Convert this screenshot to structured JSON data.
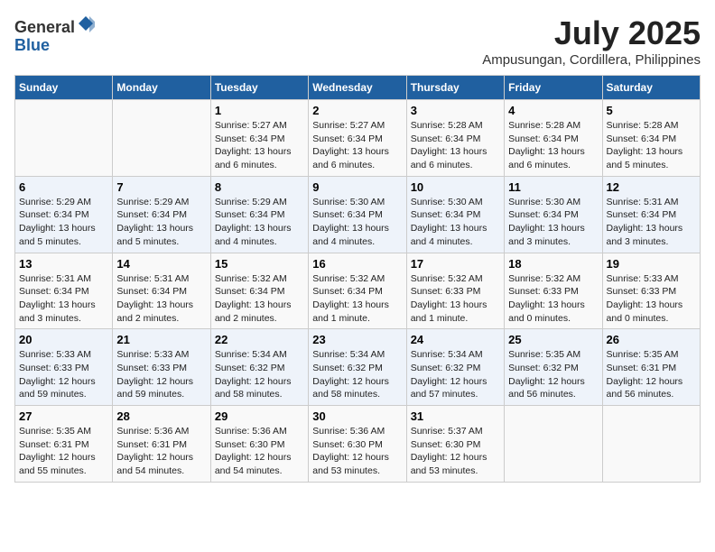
{
  "header": {
    "logo_general": "General",
    "logo_blue": "Blue",
    "month_title": "July 2025",
    "subtitle": "Ampusungan, Cordillera, Philippines"
  },
  "days_of_week": [
    "Sunday",
    "Monday",
    "Tuesday",
    "Wednesday",
    "Thursday",
    "Friday",
    "Saturday"
  ],
  "weeks": [
    [
      {
        "day": "",
        "info": ""
      },
      {
        "day": "",
        "info": ""
      },
      {
        "day": "1",
        "info": "Sunrise: 5:27 AM\nSunset: 6:34 PM\nDaylight: 13 hours and 6 minutes."
      },
      {
        "day": "2",
        "info": "Sunrise: 5:27 AM\nSunset: 6:34 PM\nDaylight: 13 hours and 6 minutes."
      },
      {
        "day": "3",
        "info": "Sunrise: 5:28 AM\nSunset: 6:34 PM\nDaylight: 13 hours and 6 minutes."
      },
      {
        "day": "4",
        "info": "Sunrise: 5:28 AM\nSunset: 6:34 PM\nDaylight: 13 hours and 6 minutes."
      },
      {
        "day": "5",
        "info": "Sunrise: 5:28 AM\nSunset: 6:34 PM\nDaylight: 13 hours and 5 minutes."
      }
    ],
    [
      {
        "day": "6",
        "info": "Sunrise: 5:29 AM\nSunset: 6:34 PM\nDaylight: 13 hours and 5 minutes."
      },
      {
        "day": "7",
        "info": "Sunrise: 5:29 AM\nSunset: 6:34 PM\nDaylight: 13 hours and 5 minutes."
      },
      {
        "day": "8",
        "info": "Sunrise: 5:29 AM\nSunset: 6:34 PM\nDaylight: 13 hours and 4 minutes."
      },
      {
        "day": "9",
        "info": "Sunrise: 5:30 AM\nSunset: 6:34 PM\nDaylight: 13 hours and 4 minutes."
      },
      {
        "day": "10",
        "info": "Sunrise: 5:30 AM\nSunset: 6:34 PM\nDaylight: 13 hours and 4 minutes."
      },
      {
        "day": "11",
        "info": "Sunrise: 5:30 AM\nSunset: 6:34 PM\nDaylight: 13 hours and 3 minutes."
      },
      {
        "day": "12",
        "info": "Sunrise: 5:31 AM\nSunset: 6:34 PM\nDaylight: 13 hours and 3 minutes."
      }
    ],
    [
      {
        "day": "13",
        "info": "Sunrise: 5:31 AM\nSunset: 6:34 PM\nDaylight: 13 hours and 3 minutes."
      },
      {
        "day": "14",
        "info": "Sunrise: 5:31 AM\nSunset: 6:34 PM\nDaylight: 13 hours and 2 minutes."
      },
      {
        "day": "15",
        "info": "Sunrise: 5:32 AM\nSunset: 6:34 PM\nDaylight: 13 hours and 2 minutes."
      },
      {
        "day": "16",
        "info": "Sunrise: 5:32 AM\nSunset: 6:34 PM\nDaylight: 13 hours and 1 minute."
      },
      {
        "day": "17",
        "info": "Sunrise: 5:32 AM\nSunset: 6:33 PM\nDaylight: 13 hours and 1 minute."
      },
      {
        "day": "18",
        "info": "Sunrise: 5:32 AM\nSunset: 6:33 PM\nDaylight: 13 hours and 0 minutes."
      },
      {
        "day": "19",
        "info": "Sunrise: 5:33 AM\nSunset: 6:33 PM\nDaylight: 13 hours and 0 minutes."
      }
    ],
    [
      {
        "day": "20",
        "info": "Sunrise: 5:33 AM\nSunset: 6:33 PM\nDaylight: 12 hours and 59 minutes."
      },
      {
        "day": "21",
        "info": "Sunrise: 5:33 AM\nSunset: 6:33 PM\nDaylight: 12 hours and 59 minutes."
      },
      {
        "day": "22",
        "info": "Sunrise: 5:34 AM\nSunset: 6:32 PM\nDaylight: 12 hours and 58 minutes."
      },
      {
        "day": "23",
        "info": "Sunrise: 5:34 AM\nSunset: 6:32 PM\nDaylight: 12 hours and 58 minutes."
      },
      {
        "day": "24",
        "info": "Sunrise: 5:34 AM\nSunset: 6:32 PM\nDaylight: 12 hours and 57 minutes."
      },
      {
        "day": "25",
        "info": "Sunrise: 5:35 AM\nSunset: 6:32 PM\nDaylight: 12 hours and 56 minutes."
      },
      {
        "day": "26",
        "info": "Sunrise: 5:35 AM\nSunset: 6:31 PM\nDaylight: 12 hours and 56 minutes."
      }
    ],
    [
      {
        "day": "27",
        "info": "Sunrise: 5:35 AM\nSunset: 6:31 PM\nDaylight: 12 hours and 55 minutes."
      },
      {
        "day": "28",
        "info": "Sunrise: 5:36 AM\nSunset: 6:31 PM\nDaylight: 12 hours and 54 minutes."
      },
      {
        "day": "29",
        "info": "Sunrise: 5:36 AM\nSunset: 6:30 PM\nDaylight: 12 hours and 54 minutes."
      },
      {
        "day": "30",
        "info": "Sunrise: 5:36 AM\nSunset: 6:30 PM\nDaylight: 12 hours and 53 minutes."
      },
      {
        "day": "31",
        "info": "Sunrise: 5:37 AM\nSunset: 6:30 PM\nDaylight: 12 hours and 53 minutes."
      },
      {
        "day": "",
        "info": ""
      },
      {
        "day": "",
        "info": ""
      }
    ]
  ]
}
